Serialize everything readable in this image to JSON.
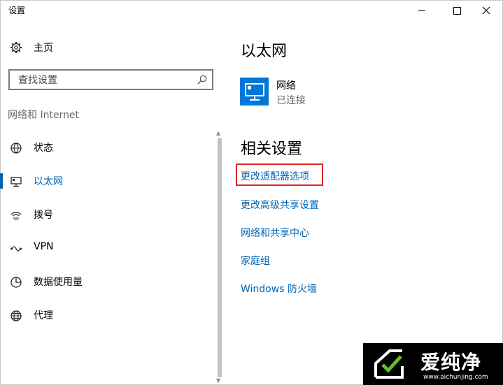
{
  "window": {
    "title": "设置",
    "icons": {
      "minimize": "minimize-icon",
      "maximize": "maximize-icon",
      "close": "close-icon"
    }
  },
  "sidebar": {
    "home": {
      "label": "主页",
      "icon": "gear-icon"
    },
    "search": {
      "placeholder": "查找设置",
      "icon": "search-icon"
    },
    "section_heading": "网络和 Internet",
    "items": [
      {
        "label": "状态",
        "icon": "globe-status-icon",
        "selected": false
      },
      {
        "label": "以太网",
        "icon": "ethernet-icon",
        "selected": true
      },
      {
        "label": "拨号",
        "icon": "dialup-icon",
        "selected": false
      },
      {
        "label": "VPN",
        "icon": "vpn-icon",
        "selected": false
      },
      {
        "label": "数据使用量",
        "icon": "data-usage-icon",
        "selected": false
      },
      {
        "label": "代理",
        "icon": "globe-icon",
        "selected": false
      }
    ]
  },
  "main": {
    "title": "以太网",
    "network": {
      "name": "网络",
      "status": "已连接",
      "icon": "ethernet-monitor-icon"
    },
    "related_heading": "相关设置",
    "links": [
      {
        "label": "更改适配器选项",
        "highlighted": true
      },
      {
        "label": "更改高级共享设置",
        "highlighted": false
      },
      {
        "label": "网络和共享中心",
        "highlighted": false
      },
      {
        "label": "家庭组",
        "highlighted": false
      },
      {
        "label": "Windows 防火墙",
        "highlighted": false
      }
    ]
  },
  "watermark": {
    "text": "爱纯净",
    "url": "www.aichunjing.com"
  },
  "colors": {
    "accent": "#0063b1",
    "tile": "#0078d7",
    "highlight": "#e02424"
  }
}
